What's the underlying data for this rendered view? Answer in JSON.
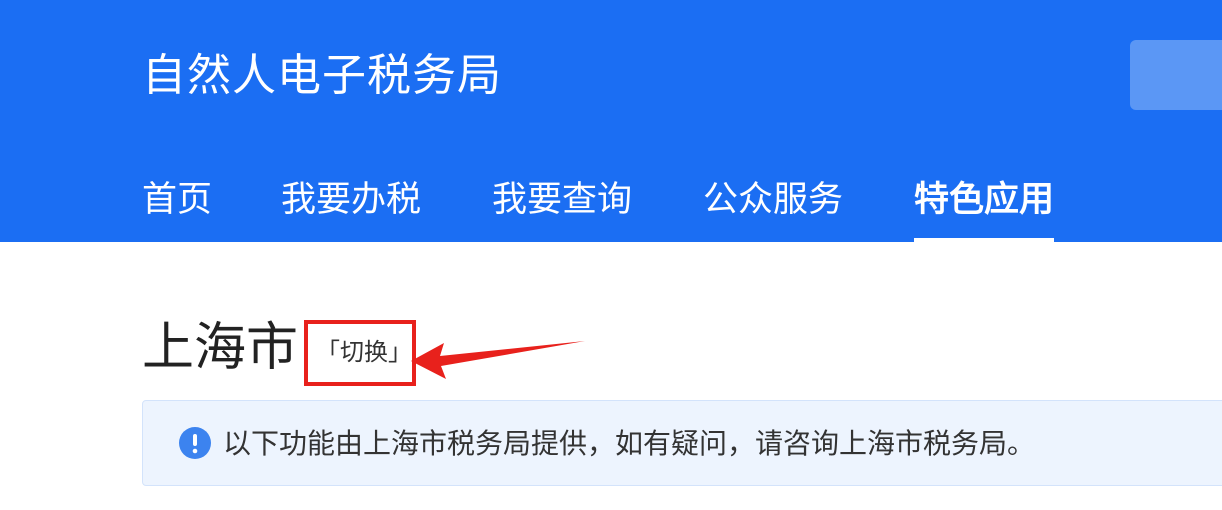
{
  "header": {
    "title": "自然人电子税务局"
  },
  "nav": {
    "items": [
      {
        "label": "首页"
      },
      {
        "label": "我要办税"
      },
      {
        "label": "我要查询"
      },
      {
        "label": "公众服务"
      },
      {
        "label": "特色应用"
      }
    ],
    "active_index": 4
  },
  "region": {
    "name": "上海市",
    "switch_label": "「切换」"
  },
  "notice": {
    "icon": "info-icon",
    "text": "以下功能由上海市税务局提供，如有疑问，请咨询上海市税务局。"
  },
  "colors": {
    "header_bg": "#1b6ef3",
    "highlight": "#e8211c",
    "notice_bg": "#edf4fe",
    "info_icon": "#3c83ef"
  }
}
